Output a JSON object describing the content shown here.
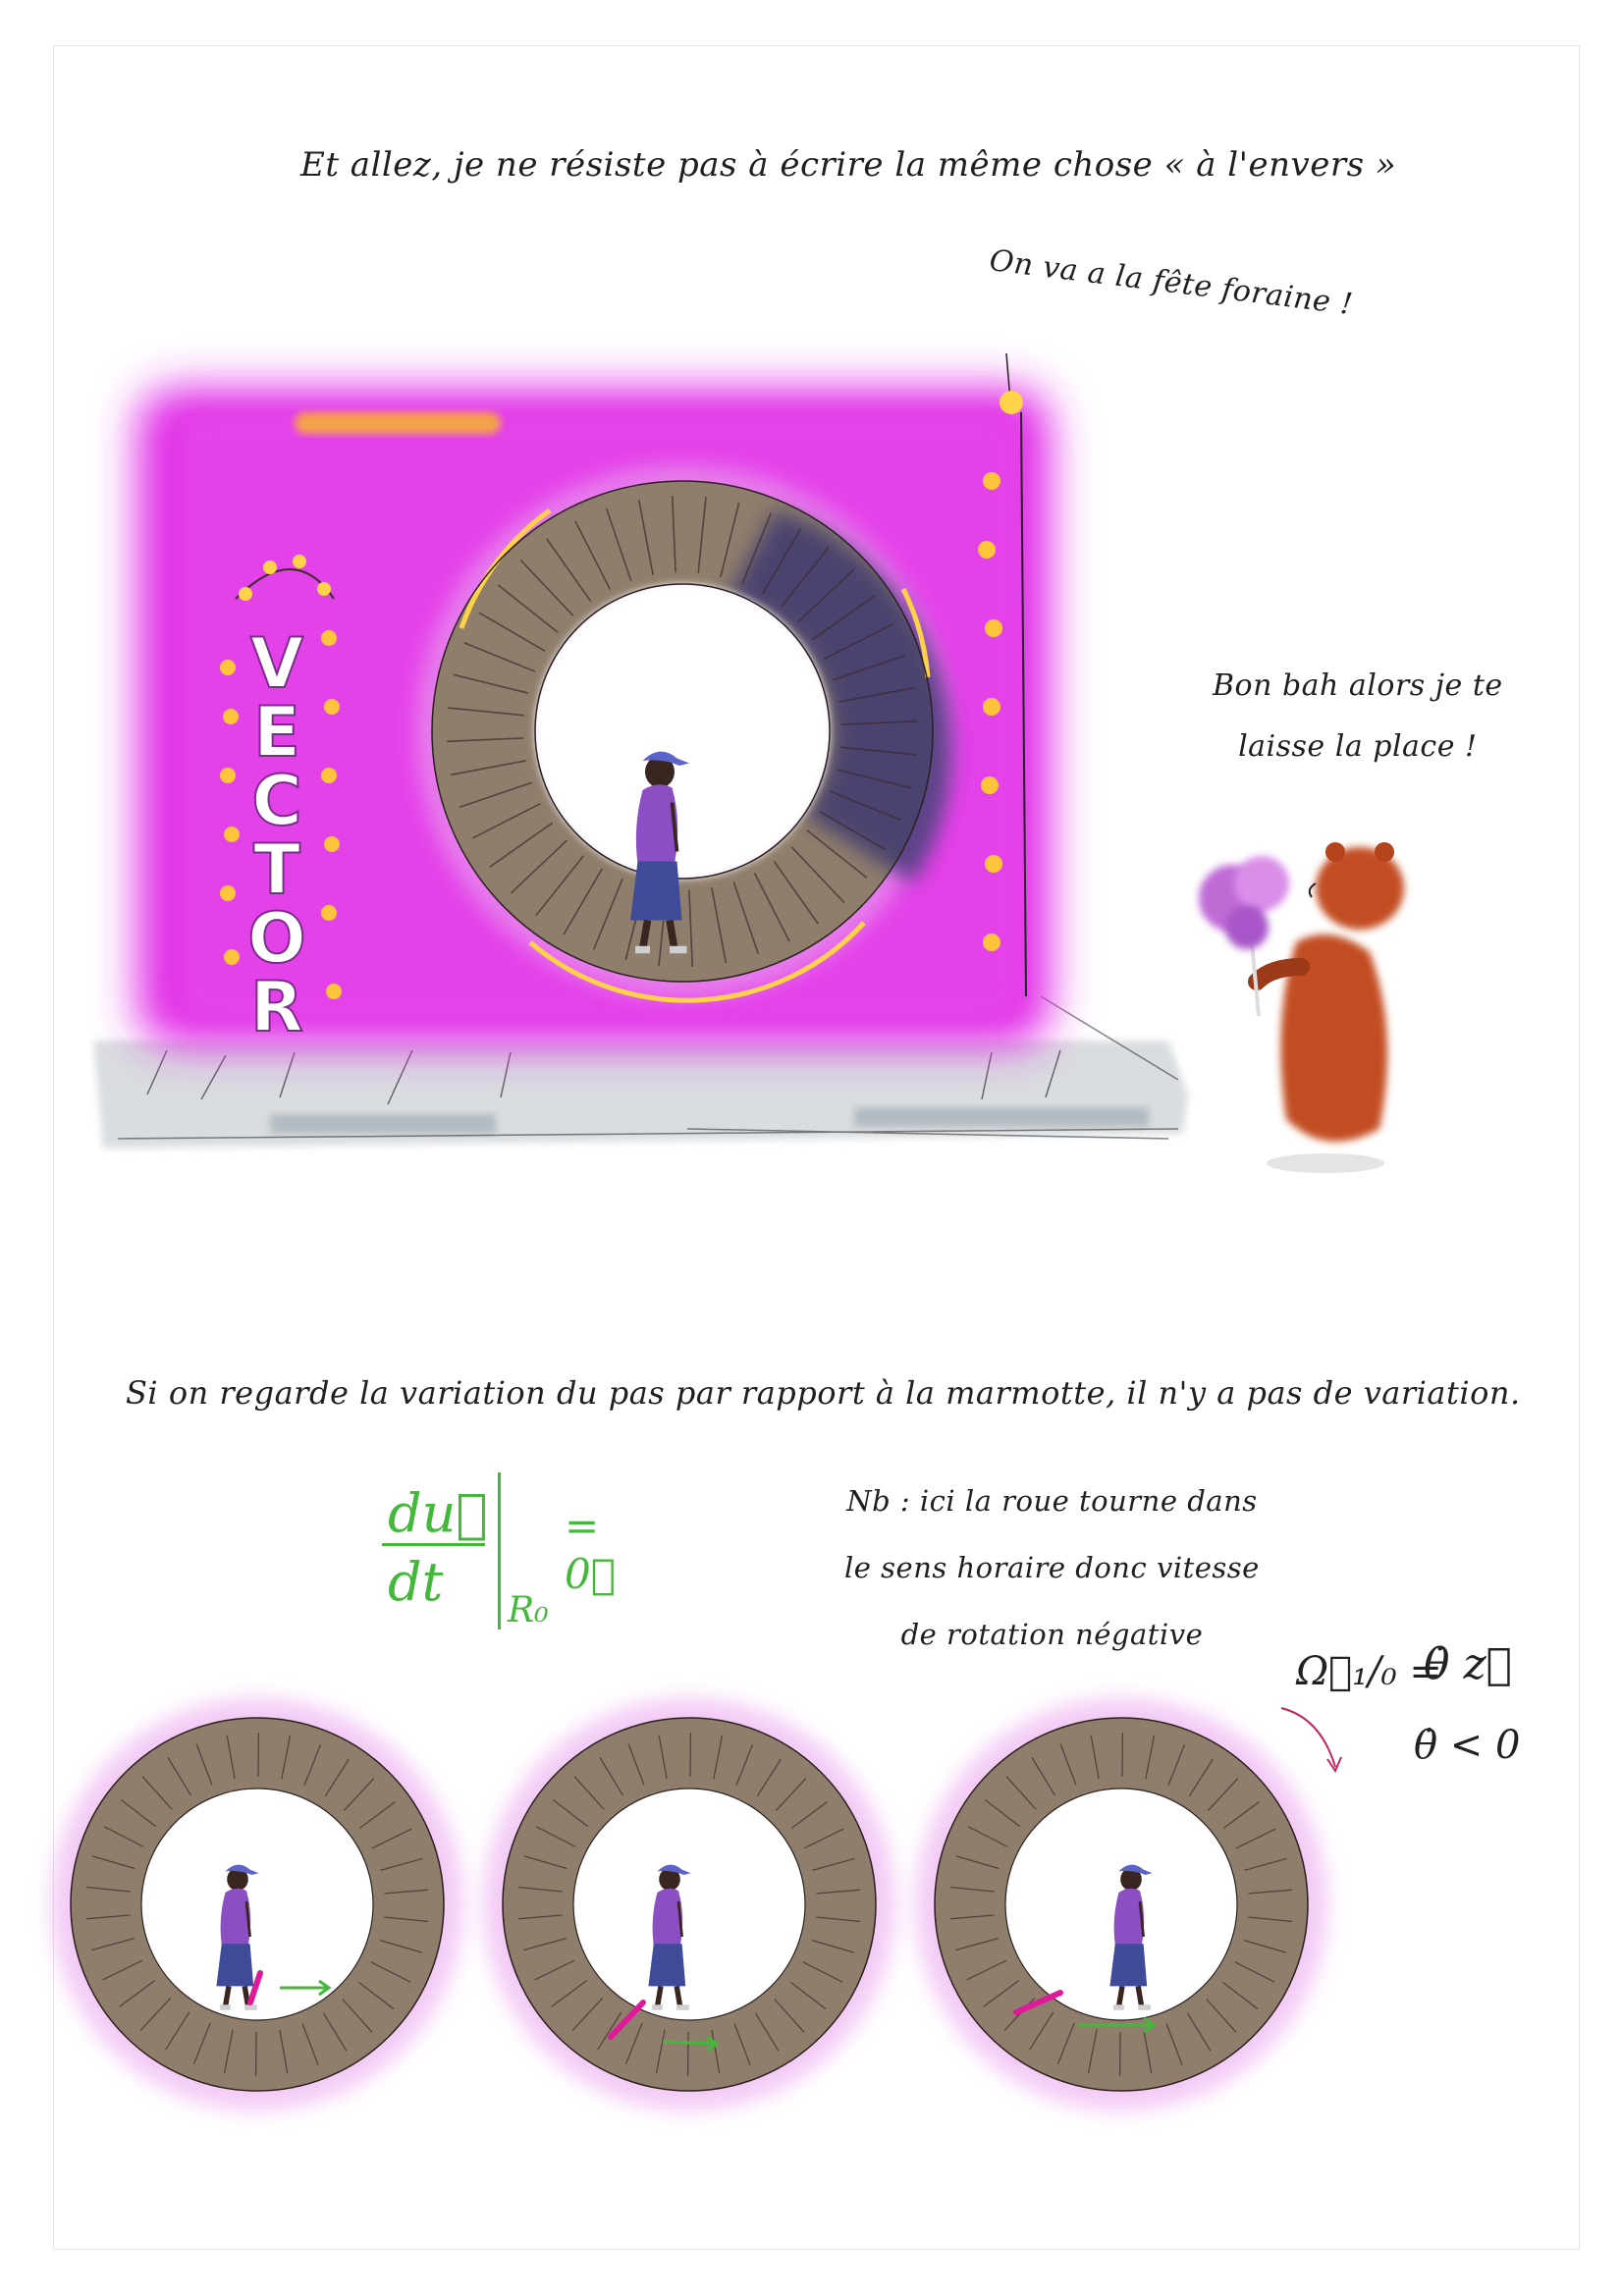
{
  "texts": {
    "title": "Et allez, je ne résiste pas à écrire la même chose « à l'envers »",
    "speech_top": "On va a la fête foraine !",
    "speech_bear_line1": "Bon bah alors je te",
    "speech_bear_line2": "laisse la place !",
    "sign": "VECTOR",
    "caption": "Si on regarde la variation du pas par rapport à la marmotte, il n'y a pas de variation.",
    "note_line1": "Nb : ici la roue tourne dans",
    "note_line2": "le sens horaire donc vitesse",
    "note_line3": "de rotation négative"
  },
  "formulas": {
    "derivative_numerator": "du⃗",
    "derivative_denominator": "dt",
    "derivative_subscript": "R₀",
    "derivative_result": "= 0⃗",
    "omega_lhs": "Ω⃗₁/₀ =",
    "omega_rhs": "θ̇ z⃗",
    "omega_condition": "θ̇ < 0"
  },
  "colors": {
    "booth_magenta": "#e02ae6",
    "wheel_brown": "#8f7e6c",
    "wheel_dark": "#3a3570",
    "formula_green": "#44b83a",
    "vector_pink": "#e0199b",
    "bear_orange": "#c24d22",
    "cotton_candy": "#c06ad6",
    "yellow_light": "#ffcc33"
  },
  "icons": [
    "carnival-booth",
    "hamster-wheel",
    "walking-person",
    "bear-with-cotton-candy",
    "curved-arrow"
  ]
}
